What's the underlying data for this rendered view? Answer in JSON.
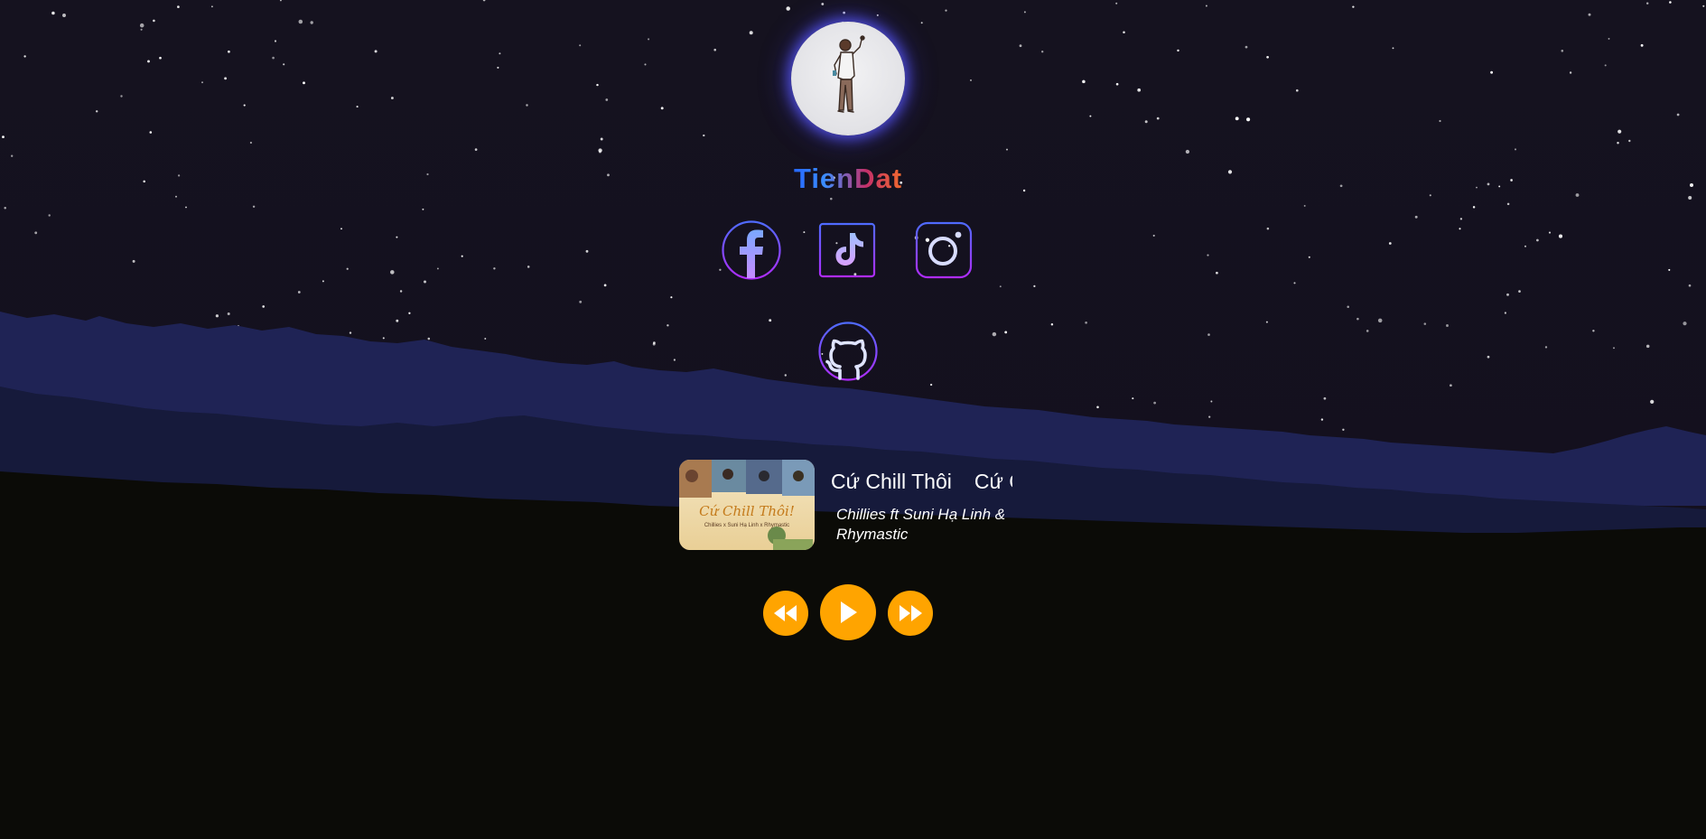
{
  "profile": {
    "name": "TienDat"
  },
  "socials": [
    {
      "label": "Facebook",
      "icon": "facebook-icon"
    },
    {
      "label": "TikTok",
      "icon": "tiktok-icon"
    },
    {
      "label": "Instagram",
      "icon": "instagram-icon"
    },
    {
      "label": "GitHub",
      "icon": "github-icon"
    }
  ],
  "player": {
    "title": "Cứ Chill Thôi",
    "artist": "Chillies ft Suni Hạ Linh & Rhymastic",
    "cover_text": "Cứ Chill Thôi!",
    "cover_subtext": "Chillies x Suni Hạ Linh x Rhymastic",
    "controls": {
      "prev_icon": "rewind-icon",
      "play_icon": "play-icon",
      "next_icon": "fast-forward-icon"
    }
  },
  "colors": {
    "sky": "#15121f",
    "mountain_back": "#1f2355",
    "mountain_mid": "#151a3a",
    "ground": "#0b0b07",
    "accent": "#ffa400",
    "social_gradient_start": "#4f6bff",
    "social_gradient_end": "#b02cff"
  }
}
